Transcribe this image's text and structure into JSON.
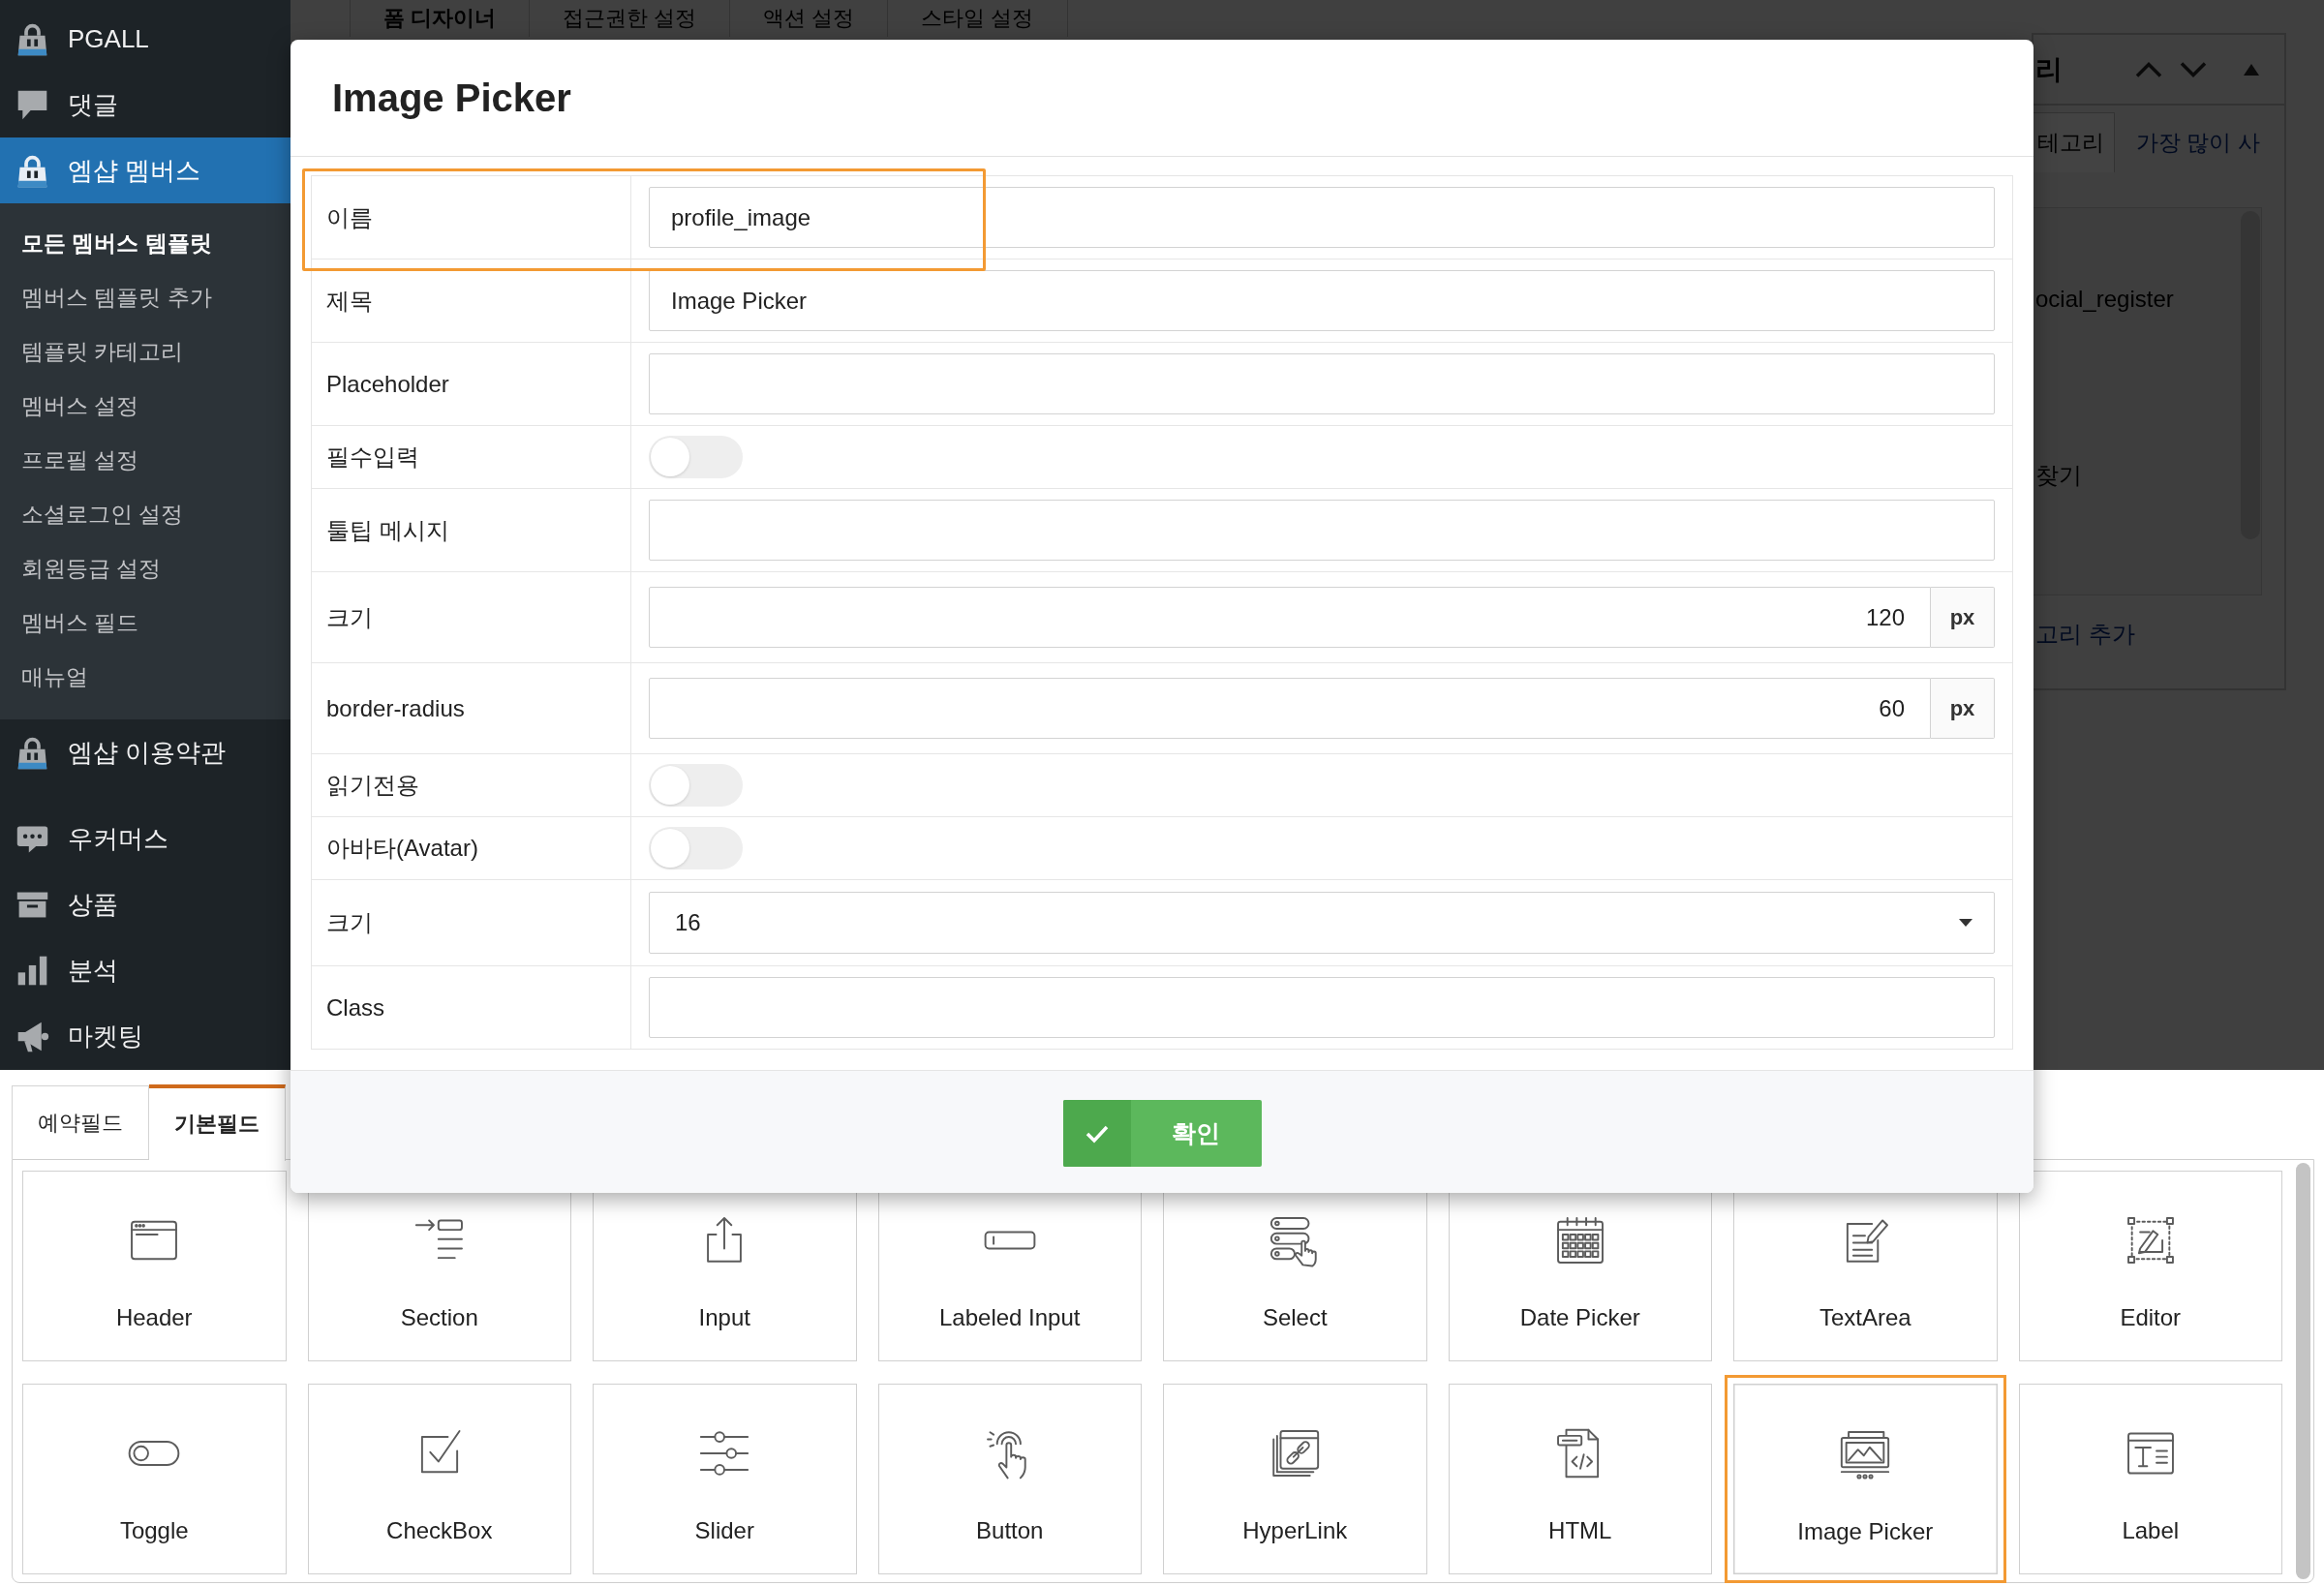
{
  "sidebar": {
    "sections": [
      {
        "items": [
          {
            "label": "PGALL",
            "kind": "plugin",
            "selected": false
          },
          {
            "label": "댓글",
            "kind": "comments",
            "selected": false
          },
          {
            "label": "엠샵 멤버스",
            "kind": "plugin",
            "selected": true,
            "children": [
              {
                "label": "모든 멤버스 템플릿",
                "selected": true
              },
              {
                "label": "멤버스 템플릿 추가",
                "selected": false
              },
              {
                "label": "템플릿 카테고리",
                "selected": false
              },
              {
                "label": "멤버스 설정",
                "selected": false
              },
              {
                "label": "프로필 설정",
                "selected": false
              },
              {
                "label": "소셜로그인 설정",
                "selected": false
              },
              {
                "label": "회원등급 설정",
                "selected": false
              },
              {
                "label": "멤버스 필드",
                "selected": false
              },
              {
                "label": "매뉴얼",
                "selected": false
              }
            ]
          },
          {
            "label": "엠샵 이용약관",
            "kind": "plugin",
            "selected": false
          }
        ]
      },
      {
        "items": [
          {
            "label": "우커머스",
            "kind": "woocommerce",
            "selected": false
          },
          {
            "label": "상품",
            "kind": "products",
            "selected": false
          },
          {
            "label": "분석",
            "kind": "analytics",
            "selected": false
          },
          {
            "label": "마켓팅",
            "kind": "marketing",
            "selected": false
          }
        ]
      }
    ]
  },
  "background_page": {
    "tabs": [
      {
        "label": "폼 디자이너",
        "selected": true
      },
      {
        "label": "접근권한 설정",
        "selected": false
      },
      {
        "label": "액션 설정",
        "selected": false
      },
      {
        "label": "스타일 설정",
        "selected": false
      }
    ],
    "side_panel": {
      "title": "리",
      "tabs": [
        {
          "label": "테고리",
          "selected": true
        },
        {
          "label": "가장 많이 사",
          "selected": false
        }
      ],
      "items": [
        "ocial_register",
        "찾기"
      ],
      "link": "고리 추가"
    }
  },
  "dialog": {
    "title": "Image Picker",
    "fields": [
      {
        "kind": "text",
        "label": "이름",
        "value": "profile_image",
        "highlighted": true
      },
      {
        "kind": "text",
        "label": "제목",
        "value": "Image Picker",
        "highlighted": false
      },
      {
        "kind": "text",
        "label": "Placeholder",
        "highlighted": false
      },
      {
        "kind": "toggle",
        "label": "필수입력",
        "on": false,
        "highlighted": false
      },
      {
        "kind": "text",
        "label": "툴팁 메시지",
        "highlighted": false
      },
      {
        "kind": "number",
        "label": "크기",
        "value": "120",
        "unit": "px",
        "highlighted": false
      },
      {
        "kind": "number",
        "label": "border-radius",
        "value": "60",
        "unit": "px",
        "highlighted": false
      },
      {
        "kind": "toggle",
        "label": "읽기전용",
        "on": false,
        "highlighted": false
      },
      {
        "kind": "toggle",
        "label": "아바타(Avatar)",
        "on": false,
        "highlighted": false
      },
      {
        "kind": "select",
        "label": "크기",
        "value": "16",
        "highlighted": false
      },
      {
        "kind": "text",
        "label": "Class",
        "highlighted": false
      }
    ],
    "buttons": [
      {
        "label": "확인"
      }
    ]
  },
  "field_palette": {
    "tabs": [
      {
        "label": "예약필드",
        "selected": false
      },
      {
        "label": "기본필드",
        "selected": true
      }
    ],
    "tiles": [
      {
        "label": "Header",
        "kind": "header",
        "selected": false
      },
      {
        "label": "Section",
        "kind": "section",
        "selected": false
      },
      {
        "label": "Input",
        "kind": "input",
        "selected": false
      },
      {
        "label": "Labeled Input",
        "kind": "labeled_input",
        "selected": false
      },
      {
        "label": "Select",
        "kind": "select",
        "selected": false
      },
      {
        "label": "Date Picker",
        "kind": "date_picker",
        "selected": false
      },
      {
        "label": "TextArea",
        "kind": "textarea",
        "selected": false
      },
      {
        "label": "Editor",
        "kind": "editor",
        "selected": false
      },
      {
        "label": "Toggle",
        "kind": "toggle",
        "selected": false
      },
      {
        "label": "CheckBox",
        "kind": "checkbox",
        "selected": false
      },
      {
        "label": "Slider",
        "kind": "slider",
        "selected": false
      },
      {
        "label": "Button",
        "kind": "button",
        "selected": false
      },
      {
        "label": "HyperLink",
        "kind": "hyperlink",
        "selected": false
      },
      {
        "label": "HTML",
        "kind": "html",
        "selected": false
      },
      {
        "label": "Image Picker",
        "kind": "image_picker",
        "selected": true
      },
      {
        "label": "Label",
        "kind": "label",
        "selected": false
      }
    ]
  }
}
